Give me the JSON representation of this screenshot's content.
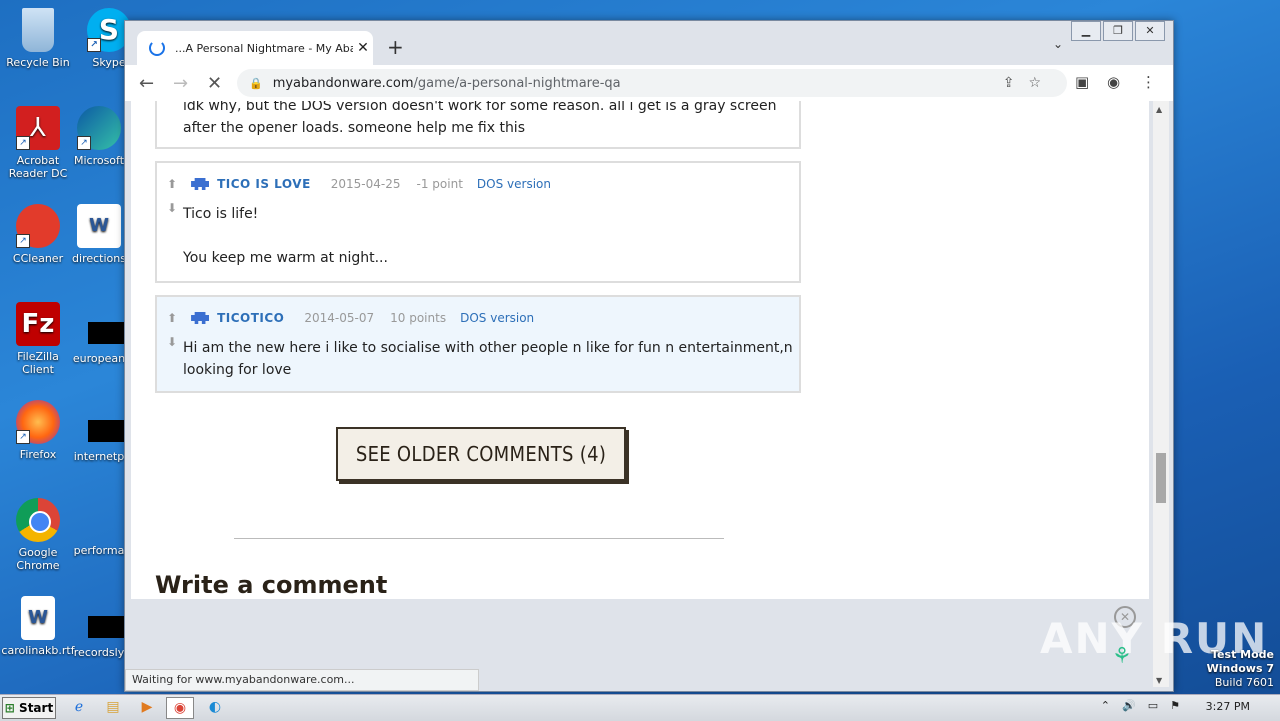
{
  "desktop": {
    "icons": [
      {
        "label": "Recycle Bin"
      },
      {
        "label": "Skype"
      },
      {
        "label": "Acrobat Reader DC"
      },
      {
        "label": "Microsoft"
      },
      {
        "label": "CCleaner"
      },
      {
        "label": "directions"
      },
      {
        "label": "FileZilla Client"
      },
      {
        "label": "european"
      },
      {
        "label": "Firefox"
      },
      {
        "label": "internetp"
      },
      {
        "label": "Google Chrome"
      },
      {
        "label": "performa"
      },
      {
        "label": "carolinakb.rtf"
      },
      {
        "label": "recordsly"
      }
    ]
  },
  "browser": {
    "tab_title": "...A Personal Nightmare - My Aband",
    "url_host": "myabandonware.com",
    "url_path": "/game/a-personal-nightmare-qa",
    "status_text": "Waiting for www.myabandonware.com..."
  },
  "page": {
    "partial_comment_text": "idk why, but the DOS version doesn't work for some reason. all i get is a gray screen after the opener loads. someone help me fix this",
    "comments": [
      {
        "user": "TICO IS LOVE",
        "date": "2015-04-25",
        "points": "-1 point",
        "version": "DOS version",
        "text_line1": "Tico is life!",
        "text_line2": "You keep me warm at night...",
        "highlighted": false
      },
      {
        "user": "TICOTICO",
        "date": "2014-05-07",
        "points": "10 points",
        "version": "DOS version",
        "text_line1": "Hi am the new here i like to socialise with other people n like for fun n entertainment,n",
        "text_line2": "looking for love",
        "highlighted": true
      }
    ],
    "older_comments_button": "SEE OLDER COMMENTS (4)",
    "write_comment_title": "Write a comment"
  },
  "overlay": {
    "watermark": "ANY RUN",
    "testmode_line1": "Test Mode",
    "testmode_line2": "Windows 7",
    "testmode_line3": "Build 7601"
  },
  "taskbar": {
    "start_label": "Start",
    "clock": "3:27 PM"
  },
  "colors": {
    "link_blue": "#2d6fb8",
    "highlight_bg": "#eef6fd",
    "button_bg": "#f3efe7"
  }
}
